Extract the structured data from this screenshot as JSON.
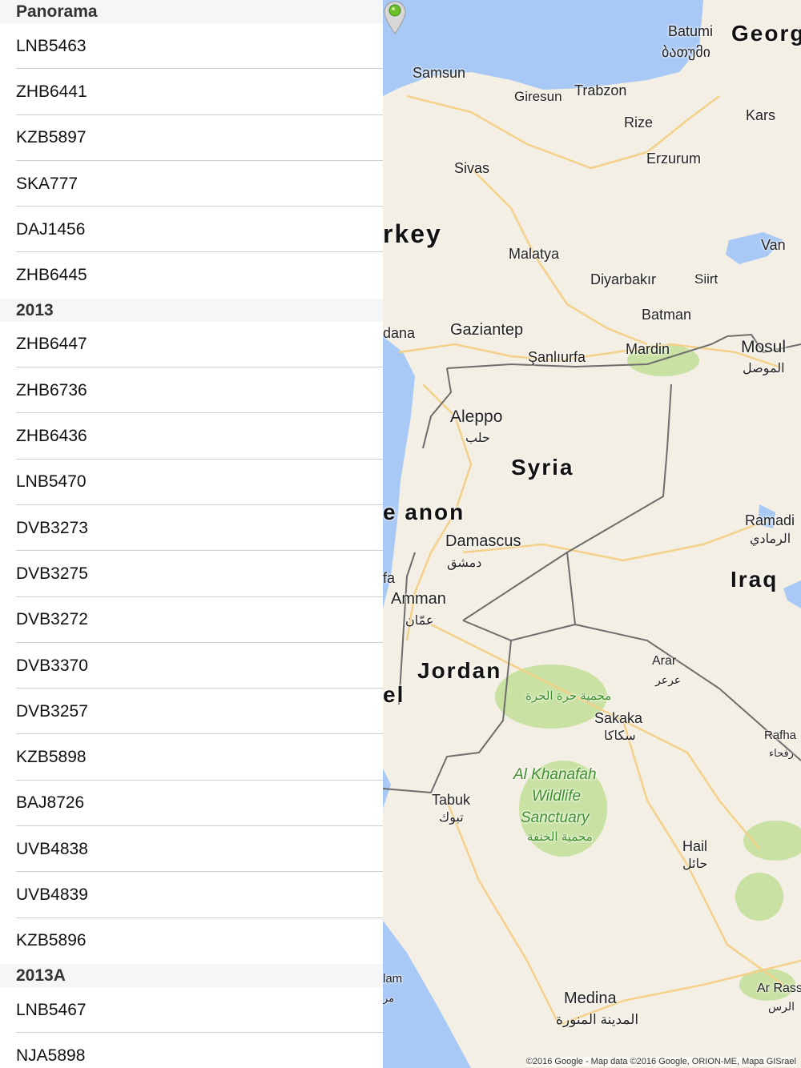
{
  "sections": [
    {
      "title": "Panorama",
      "items": [
        "LNB5463",
        "ZHB6441",
        "KZB5897",
        "SKA777",
        "DAJ1456",
        "ZHB6445"
      ]
    },
    {
      "title": "2013",
      "items": [
        "ZHB6447",
        "ZHB6736",
        "ZHB6436",
        "LNB5470",
        "DVB3273",
        "DVB3275",
        "DVB3272",
        "DVB3370",
        "DVB3257",
        "KZB5898",
        "BAJ8726",
        "UVB4838",
        "UVB4839",
        "KZB5896"
      ]
    },
    {
      "title": "2013A",
      "items": [
        "LNB5467",
        "NJA5898"
      ]
    }
  ],
  "map": {
    "labels": {
      "georgia": "Georg",
      "batumi": "Batumi",
      "batumi_ka": "ბათუმი",
      "samsun": "Samsun",
      "giresun": "Giresun",
      "trabzon": "Trabzon",
      "rize": "Rize",
      "kars": "Kars",
      "erzurum": "Erzurum",
      "sivas": "Sivas",
      "turkey": "rkey",
      "malatya": "Malatya",
      "van": "Van",
      "diyarbakir": "Diyarbakır",
      "siirt": "Siirt",
      "batman": "Batman",
      "adana": "dana",
      "gaziantep": "Gaziantep",
      "sanliurfa": "Şanlıurfa",
      "mardin": "Mardin",
      "mosul": "Mosul",
      "mosul_ar": "الموصل",
      "aleppo": "Aleppo",
      "aleppo_ar": "حلب",
      "syria": "Syria",
      "lebanon": "e  anon",
      "damascus": "Damascus",
      "damascus_ar": "دمشق",
      "ramadi": "Ramadi",
      "ramadi_ar": "الرمادي",
      "iraq": "Iraq",
      "amman": "Amman",
      "amman_ar": "عمّان",
      "fa": "fa",
      "jordan": "Jordan",
      "israel": "el",
      "arar": "Arar",
      "arar_ar": "عرعر",
      "harrat": "محمية حرة الحرة",
      "sakaka": "Sakaka",
      "sakaka_ar": "سكاكا",
      "rafha": "Rafha",
      "rafha_ar": "رفحاء",
      "khanafah_1": "Al Khanafah",
      "khanafah_2": "Wildlife",
      "khanafah_3": "Sanctuary",
      "khanafah_ar": "محمية الخنفة",
      "tabuk": "Tabuk",
      "tabuk_ar": "تبوك",
      "hail": "Hail",
      "hail_ar": "حائل",
      "lam": "lam",
      "lam_ar": "مر",
      "medina": "Medina",
      "medina_ar": "المدينة المنورة",
      "ar_rass": "Ar Rass",
      "ar_rass_ar": "الرس"
    },
    "copyright": "©2016 Google - Map data ©2016 Google, ORION-ME, Mapa GISrael",
    "colors": {
      "water": "#a8c8f5",
      "land": "#f4efe4",
      "park": "#c9e2a4",
      "road": "#f3d18a",
      "border": "#6d6d6d"
    }
  }
}
